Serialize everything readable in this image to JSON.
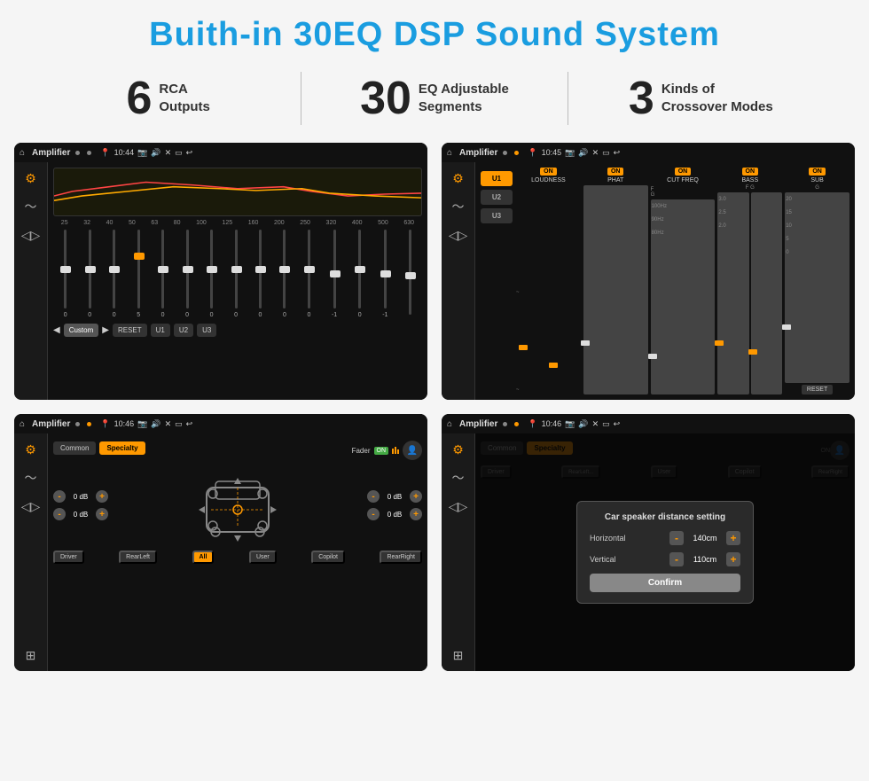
{
  "page": {
    "title": "Buith-in 30EQ DSP Sound System",
    "stats": [
      {
        "number": "6",
        "label": "RCA\nOutputs"
      },
      {
        "number": "30",
        "label": "EQ Adjustable\nSegments"
      },
      {
        "number": "3",
        "label": "Kinds of\nCrossover Modes"
      }
    ]
  },
  "screens": [
    {
      "id": "eq-screen",
      "status": {
        "title": "Amplifier",
        "time": "10:44"
      },
      "type": "eq"
    },
    {
      "id": "dsp-screen",
      "status": {
        "title": "Amplifier",
        "time": "10:45"
      },
      "type": "dsp"
    },
    {
      "id": "specialty-screen",
      "status": {
        "title": "Amplifier",
        "time": "10:46"
      },
      "type": "specialty"
    },
    {
      "id": "dialog-screen",
      "status": {
        "title": "Amplifier",
        "time": "10:46"
      },
      "type": "dialog",
      "dialog": {
        "title": "Car speaker distance setting",
        "horizontal_label": "Horizontal",
        "horizontal_value": "140cm",
        "vertical_label": "Vertical",
        "vertical_value": "110cm",
        "confirm_label": "Confirm"
      }
    }
  ],
  "eq": {
    "freqs": [
      "25",
      "32",
      "40",
      "50",
      "63",
      "80",
      "100",
      "125",
      "160",
      "200",
      "250",
      "320",
      "400",
      "500",
      "630"
    ],
    "values": [
      "0",
      "0",
      "0",
      "5",
      "0",
      "0",
      "0",
      "0",
      "0",
      "0",
      "0",
      "-1",
      "0",
      "-1",
      ""
    ],
    "presets": [
      "Custom",
      "RESET",
      "U1",
      "U2",
      "U3"
    ]
  },
  "dsp": {
    "presets": [
      "U1",
      "U2",
      "U3"
    ],
    "channels": [
      "LOUDNESS",
      "PHAT",
      "CUT FREQ",
      "BASS",
      "SUB"
    ],
    "reset": "RESET"
  },
  "specialty": {
    "tabs": [
      "Common",
      "Specialty"
    ],
    "fader_label": "Fader",
    "fader_on": "ON",
    "db_values": [
      "0 dB",
      "0 dB",
      "0 dB",
      "0 dB"
    ],
    "speaker_btns": [
      "Driver",
      "Copilot",
      "RearLeft",
      "All",
      "User",
      "RearRight"
    ]
  },
  "dialog": {
    "title": "Car speaker distance setting",
    "horizontal": "Horizontal",
    "horizontal_val": "140cm",
    "vertical": "Vertical",
    "vertical_val": "110cm",
    "confirm": "Confirm"
  }
}
